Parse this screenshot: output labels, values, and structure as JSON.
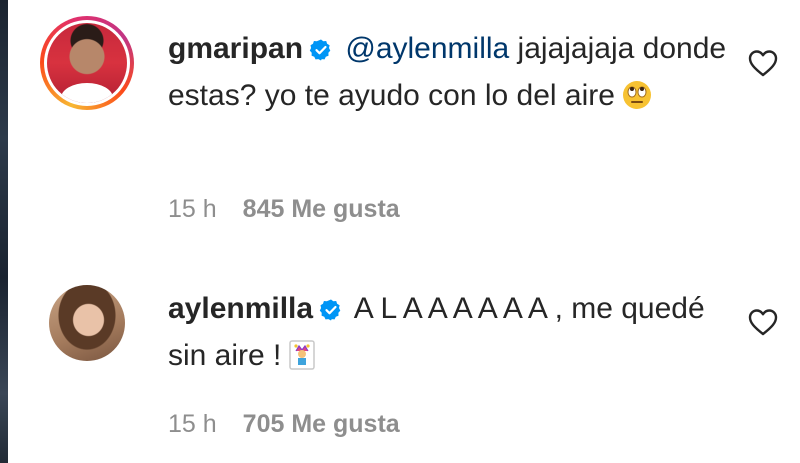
{
  "comments": [
    {
      "username": "gmaripan",
      "mention": "@aylenmilla",
      "text": " jajajajaja donde estas? yo te ayudo con lo del aire",
      "emoji": "eye-roll-emoji",
      "time": "15 h",
      "likes": "845 Me gusta"
    },
    {
      "username": "aylenmilla",
      "mention": "",
      "text": "A L A A A A A A , me quedé sin aire !",
      "emoji": "jester-emoji",
      "time": "15 h",
      "likes": "705 Me gusta"
    }
  ],
  "colors": {
    "text": "#262626",
    "mention": "#00376b",
    "meta": "#8e8e8e",
    "verified": "#0095f6"
  },
  "icons": [
    "verified-badge-icon",
    "heart-icon"
  ]
}
